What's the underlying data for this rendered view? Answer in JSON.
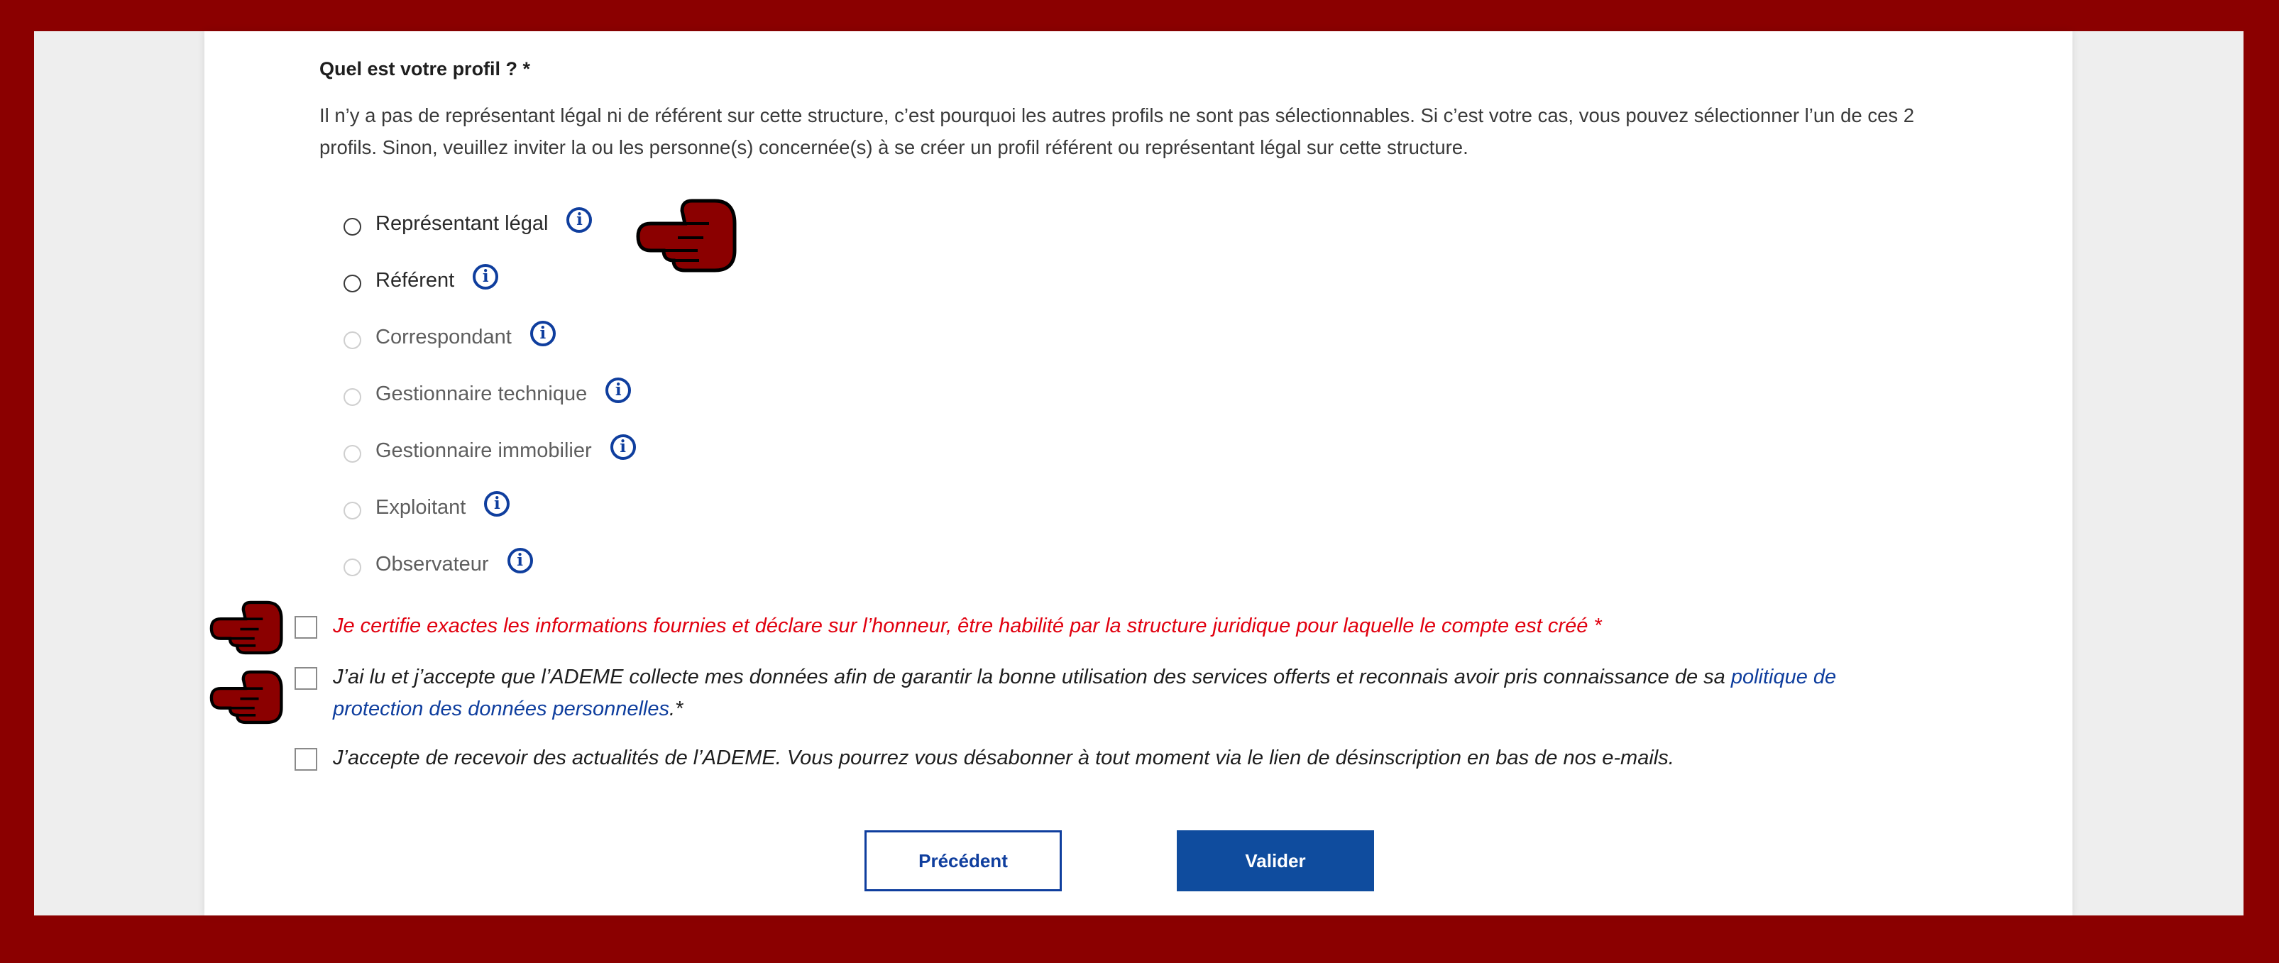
{
  "form": {
    "question_title": "Quel est votre profil ? *",
    "info_text": "Il n’y a pas de représentant légal ni de référent sur cette structure, c’est pourquoi les autres profils ne sont pas sélectionnables. Si c’est votre cas, vous pouvez sélectionner l’un de ces 2 profils. Sinon, veuillez inviter la ou les personne(s) concernée(s) à se créer un profil référent ou représentant légal sur cette structure.",
    "profiles": [
      {
        "label": "Représentant légal",
        "enabled": true
      },
      {
        "label": "Référent",
        "enabled": true
      },
      {
        "label": "Correspondant",
        "enabled": false
      },
      {
        "label": "Gestionnaire technique",
        "enabled": false
      },
      {
        "label": "Gestionnaire immobilier",
        "enabled": false
      },
      {
        "label": "Exploitant",
        "enabled": false
      },
      {
        "label": "Observateur",
        "enabled": false
      }
    ],
    "info_icon_glyph": "i",
    "checkboxes": {
      "certify": "Je certifie exactes les informations fournies et déclare sur l’honneur, être habilité par la structure juridique pour laquelle le compte est créé *",
      "consent_text": "J’ai lu et j’accepte que l’ADEME collecte mes données afin de garantir la bonne utilisation des services offerts et reconnais avoir pris connaissance de sa",
      "consent_link": "politique de protection des données personnelles",
      "consent_suffix": ".*",
      "newsletter": "J’accepte de recevoir des actualités de l’ADEME. Vous pourrez vous désabonner à tout moment via le lien de désinscription en bas de nos e-mails."
    },
    "buttons": {
      "previous": "Précédent",
      "submit": "Valider"
    }
  },
  "colors": {
    "frame": "#8b0000",
    "primary_blue": "#0f4c9e",
    "required_red": "#e1000f"
  },
  "annotations": [
    {
      "icon": "pointing-hand-icon",
      "target": "Représentant légal"
    },
    {
      "icon": "pointing-hand-icon",
      "target": "certify-checkbox"
    },
    {
      "icon": "pointing-hand-icon",
      "target": "consent-checkbox"
    }
  ]
}
